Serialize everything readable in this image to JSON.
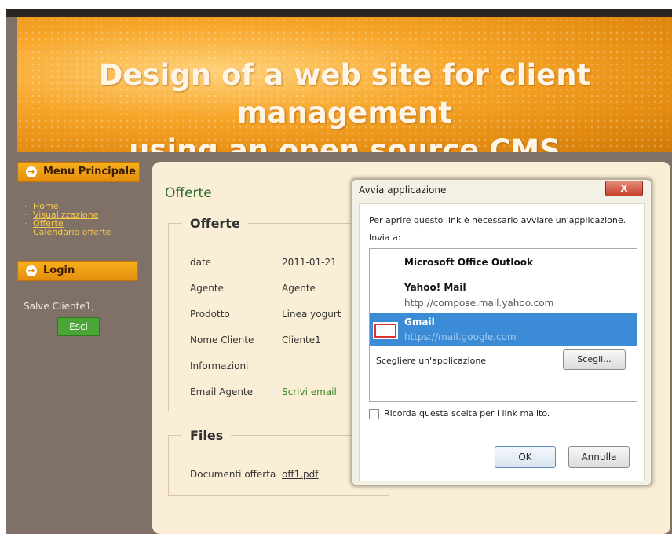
{
  "banner": {
    "line1": "Design of a web site for client management",
    "line2": "using an open source CMS"
  },
  "sidebar": {
    "menu_title": "Menu Principale",
    "links": [
      "Home",
      "Visualizzazione",
      "Offerte",
      "Calendario offerte"
    ],
    "login_title": "Login",
    "greeting": "Salve Cliente1,",
    "logout_label": "Esci"
  },
  "main": {
    "page_title": "Offerte",
    "offerte_legend": "Offerte",
    "rows": [
      {
        "key": "date",
        "value": "2011-01-21"
      },
      {
        "key": "Agente",
        "value": "Agente"
      },
      {
        "key": "Prodotto",
        "value": "Linea yogurt"
      },
      {
        "key": "Nome Cliente",
        "value": "Cliente1"
      },
      {
        "key": "Informazioni",
        "value": ""
      },
      {
        "key": "Email Agente",
        "value": "Scrivi email"
      }
    ],
    "files_legend": "Files",
    "files_key": "Documenti offerta",
    "files_value": "off1.pdf"
  },
  "dialog": {
    "title": "Avvia applicazione",
    "close_label": "X",
    "message": "Per aprire questo link è necessario avviare un'applicazione.",
    "send_to": "Invia a:",
    "apps": [
      {
        "name": "Microsoft Office Outlook",
        "url": ""
      },
      {
        "name": "Yahoo! Mail",
        "url": "http://compose.mail.yahoo.com"
      },
      {
        "name": "Gmail",
        "url": "https://mail.google.com"
      }
    ],
    "choose_app": "Scegliere un'applicazione",
    "choose_button": "Scegli...",
    "remember": "Ricorda questa scelta per i link mailto.",
    "ok": "OK",
    "cancel": "Annulla"
  },
  "colors": {
    "accent_orange": "#e48c0c",
    "green_text": "#2d6b2d",
    "selection_blue": "#3b8bd6"
  }
}
